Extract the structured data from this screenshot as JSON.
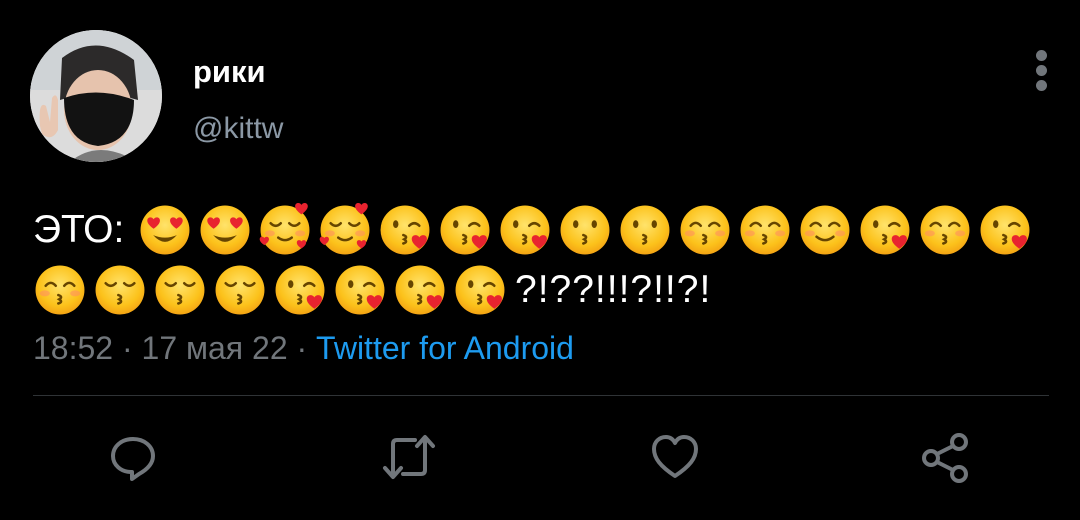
{
  "tweet": {
    "author": {
      "display_name": "рики",
      "handle": "@kittw"
    },
    "text_prefix": "ЭТО:",
    "emoji_line_1": [
      "heart-eyes",
      "heart-eyes",
      "smiling-hearts",
      "smiling-hearts",
      "kiss-heart",
      "kiss-heart",
      "kiss-heart",
      "kissing",
      "kissing",
      "kissing-closed-eyes",
      "kissing-closed-eyes",
      "smiling-blush",
      "kiss-heart",
      "kissing-closed-eyes",
      "kiss-heart"
    ],
    "emoji_line_2": [
      "kissing-closed-eyes",
      "kissing-smiling-eyes",
      "kissing-smiling-eyes",
      "kissing-smiling-eyes",
      "kiss-heart",
      "kiss-heart",
      "kiss-heart",
      "kiss-heart"
    ],
    "text_suffix": "?!??!!!?!!?!",
    "time": "18:52",
    "separator": "·",
    "date": "17 мая 22",
    "source": "Twitter for Android"
  },
  "actions": {
    "reply": "reply-icon",
    "retweet": "retweet-icon",
    "like": "heart-icon",
    "share": "share-icon"
  },
  "colors": {
    "background": "#000000",
    "text": "#ffffff",
    "secondary": "#71767b",
    "link": "#1d9bf0",
    "divider": "#2f3336"
  }
}
